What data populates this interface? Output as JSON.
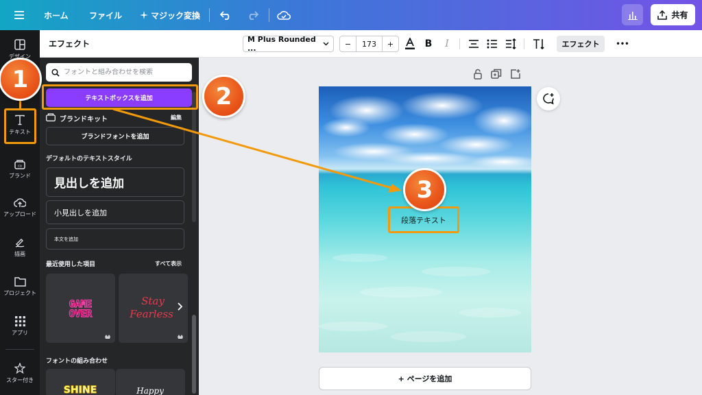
{
  "topbar": {
    "menu_icon": "hamburger-icon",
    "home": "ホーム",
    "file": "ファイル",
    "magic": "マジック変換",
    "magic_icon": "sparkle-icon",
    "undo_icon": "undo-icon",
    "redo_icon": "redo-icon",
    "save_status_icon": "cloud-check-icon",
    "stats_icon": "bar-chart-icon",
    "share_icon": "share-upload-icon",
    "share": "共有",
    "gradient_colors": [
      "#13a6c4",
      "#3b78d8",
      "#7353e6"
    ]
  },
  "rail": {
    "items": [
      {
        "label": "デザイン",
        "icon": "layout-icon"
      },
      {
        "label": "テキスト",
        "icon": "text-t-icon"
      },
      {
        "label": "ブランド",
        "icon": "brand-kit-icon"
      },
      {
        "label": "アップロード",
        "icon": "cloud-upload-icon"
      },
      {
        "label": "描画",
        "icon": "draw-pen-icon"
      },
      {
        "label": "プロジェクト",
        "icon": "folder-icon"
      },
      {
        "label": "アプリ",
        "icon": "apps-grid-icon"
      },
      {
        "label": "スター付き",
        "icon": "star-icon"
      }
    ]
  },
  "panel": {
    "header": "エフェクト",
    "search_placeholder": "フォントと組み合わせを検索",
    "add_textbox": "テキストボックスを追加",
    "brand_kit": "ブランドキット",
    "brand_kit_edit": "編集",
    "brand_font_add": "ブランドフォントを追加",
    "default_styles": "デフォルトのテキストスタイル",
    "add_heading": "見出しを追加",
    "add_subheading": "小見出しを追加",
    "add_body": "本文を追加",
    "recent": "最近使用した項目",
    "see_all": "すべて表示",
    "recent_items": [
      {
        "line1": "GAME",
        "line2": "OVER"
      },
      {
        "line1": "Stay",
        "line2": "Fearless"
      }
    ],
    "font_combos": "フォントの組み合わせ",
    "combo_items": [
      "SHINE",
      "Happy"
    ],
    "accent_color": "#8b3dff"
  },
  "toolbar": {
    "font_name": "M Plus Rounded ...",
    "font_size": "173",
    "minus": "−",
    "plus": "+",
    "text_color_icon": "text-color-a-icon",
    "bold": "B",
    "italic": "I",
    "align_icon": "align-center-icon",
    "list_icon": "bullet-list-icon",
    "spacing_icon": "line-spacing-icon",
    "vertical_icon": "vertical-text-icon",
    "effect": "エフェクト",
    "more": "•••"
  },
  "canvas": {
    "paragraph_text": "段落テキスト",
    "add_page": "+ ページを追加",
    "page_lock_icon": "lock-icon",
    "page_duplicate_icon": "duplicate-icon",
    "page_add_icon": "add-page-icon",
    "comment_icon": "comment-add-icon"
  },
  "annotations": {
    "steps": [
      "1",
      "2",
      "3"
    ],
    "highlight_color": "#f29a0c"
  }
}
